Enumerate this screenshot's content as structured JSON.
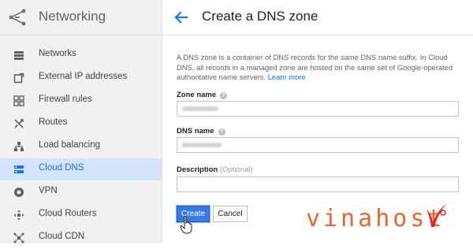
{
  "sidebar": {
    "title": "Networking",
    "items": [
      {
        "label": "Networks",
        "icon": "networks-icon"
      },
      {
        "label": "External IP addresses",
        "icon": "external-ip-icon"
      },
      {
        "label": "Firewall rules",
        "icon": "firewall-icon"
      },
      {
        "label": "Routes",
        "icon": "routes-icon"
      },
      {
        "label": "Load balancing",
        "icon": "load-balancing-icon"
      },
      {
        "label": "Cloud DNS",
        "icon": "cloud-dns-icon",
        "active": true
      },
      {
        "label": "VPN",
        "icon": "vpn-icon"
      },
      {
        "label": "Cloud Routers",
        "icon": "cloud-routers-icon"
      },
      {
        "label": "Cloud CDN",
        "icon": "cloud-cdn-icon"
      }
    ]
  },
  "header": {
    "title": "Create a DNS zone"
  },
  "form": {
    "description": "A DNS zone is a container of DNS records for the same DNS name suffix. In Cloud DNS, all records in a managed zone are hosted on the same set of Google-operated authoritative name servers.",
    "learn_more": "Learn more",
    "zone_name_label": "Zone name",
    "dns_name_label": "DNS name",
    "description_label": "Description",
    "description_optional": "(Optional)",
    "description_value": ""
  },
  "buttons": {
    "create": "Create",
    "cancel": "Cancel"
  },
  "watermark": {
    "text": "vinahost",
    "brand_color": "#e8672c"
  },
  "colors": {
    "accent": "#1a73e8",
    "active_bg": "#d4e4fb",
    "primary_button": "#3b78e7"
  }
}
